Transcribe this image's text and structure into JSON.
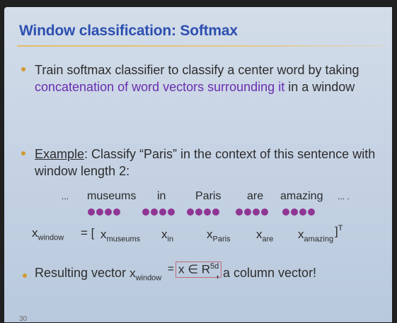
{
  "title": "Window classification: Softmax",
  "bullets": [
    {
      "text_a": "Train softmax classifier to classify a center word by taking",
      "text_b_purple": "concatenation of word vectors surrounding it",
      "text_b_tail": " in a window"
    },
    {
      "label": "Example",
      "text_a": ": Classify “Paris” in the context of this sentence with",
      "text_b": "window length 2:"
    },
    {
      "text_a": "Resulting vector ",
      "text_b": ", a column vector!"
    }
  ],
  "sentence": {
    "ellipsis_left": "...",
    "words": [
      "museums",
      "in",
      "Paris",
      "are",
      "amazing"
    ],
    "ellipsis_right": "... ."
  },
  "equation": {
    "lhs": "x",
    "lhs_sub": "window",
    "eq": "= [",
    "terms": [
      {
        "x": "x",
        "sub": "museums"
      },
      {
        "x": "x",
        "sub": "in"
      },
      {
        "x": "x",
        "sub": "Paris"
      },
      {
        "x": "x",
        "sub": "are"
      },
      {
        "x": "x",
        "sub": "amazing"
      }
    ],
    "rhs": "]",
    "sup": "T"
  },
  "result": {
    "x": "x",
    "sub": "window",
    "eq": "=",
    "boxed": "x ∈ R",
    "boxed_sup": "5d"
  },
  "page_number": "30",
  "colors": {
    "title": "#2d4fb0",
    "bullet_dot": "#d09a2f",
    "dots": "#8f3593",
    "purple_text": "#6a2db0"
  }
}
